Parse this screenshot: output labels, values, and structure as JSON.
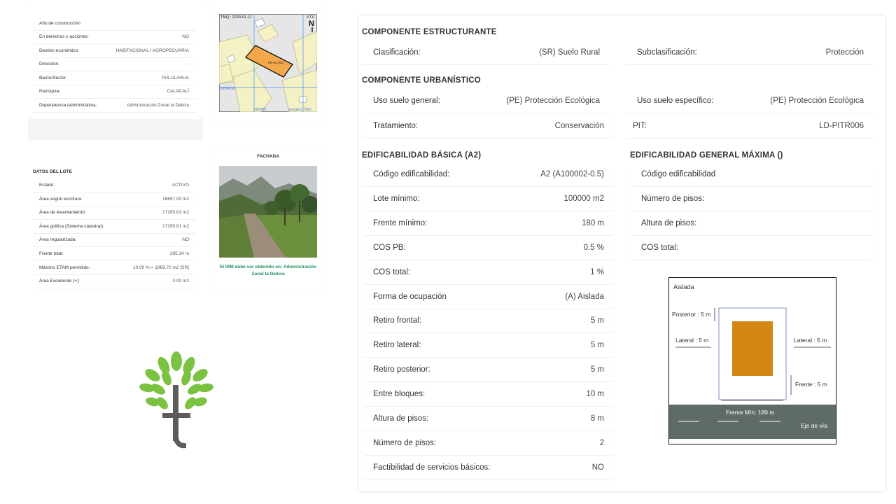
{
  "property_info": {
    "rows": [
      {
        "label": "Año de construcción",
        "value": ""
      },
      {
        "label": "En derechos y acciones:",
        "value": "NO"
      },
      {
        "label": "Destino económico:",
        "value": "HABITACIONAL / AGROPECUARIA"
      },
      {
        "label": "Dirección:",
        "value": "-"
      },
      {
        "label": "Barrio/Sector:",
        "value": "PULULAHUA"
      },
      {
        "label": "Parroquia:",
        "value": "CALACALÍ"
      },
      {
        "label": "Dependencia Administrativa:",
        "value": "Administración Zonal la Delicia"
      }
    ]
  },
  "map": {
    "date_label": "TMQ : 2023-01-11",
    "corner_label": "V.T.0",
    "north": "N",
    "lot_label": "FE-A2 (A1)",
    "coord_left": "10034700",
    "coord_bottom": "501600",
    "scale": "Escala 1:7500"
  },
  "lote": {
    "title": "DATOS DEL LOTE",
    "rows": [
      {
        "label": "Estado:",
        "value": "ACTIVO"
      },
      {
        "label": "Área según escritura:",
        "value": "18697.00 m2"
      },
      {
        "label": "Área de levantamiento:",
        "value": "17295.63 m2"
      },
      {
        "label": "Área gráfica (Sistema catastral):",
        "value": "17295.81 m2"
      },
      {
        "label": "Área regularizada:",
        "value": "NO"
      },
      {
        "label": "Frente total:",
        "value": "285.34 m"
      },
      {
        "label": "Máximo ETAM permitido:",
        "value": "10.00 % = 1869.70 m2 [SR]"
      },
      {
        "label": "Área Excedente (+):",
        "value": "0.00 m2"
      }
    ]
  },
  "fachada": {
    "title": "FACHADA",
    "note": "El IRM debe ser obtenido en: Administración Zonal la Delicia"
  },
  "componente_estructurante": {
    "title": "COMPONENTE ESTRUCTURANTE",
    "clasificacion_label": "Clasificación:",
    "clasificacion_value": "(SR) Suelo Rural",
    "subclasificacion_label": "Subclasificación:",
    "subclasificacion_value": "Protección"
  },
  "componente_urbanistico": {
    "title": "COMPONENTE URBANÍSTICO",
    "uso_general_label": "Uso suelo general:",
    "uso_general_value": "(PE) Protección Ecológica",
    "uso_especifico_label": "Uso suelo específico:",
    "uso_especifico_value": "(PE) Protección Ecológica",
    "tratamiento_label": "Tratamiento:",
    "tratamiento_value": "Conservación",
    "pit_label": "PIT:",
    "pit_value": "LD-PITR006"
  },
  "edificabilidad_basica": {
    "title": "EDIFICABILIDAD BÁSICA (A2)",
    "rows": [
      {
        "label": "Código edificabilidad:",
        "value": "A2 (A100002-0.5)"
      },
      {
        "label": "Lote mínimo:",
        "value": "100000 m2"
      },
      {
        "label": "Frente mínimo:",
        "value": "180 m"
      },
      {
        "label": "COS PB:",
        "value": "0.5 %"
      },
      {
        "label": "COS total:",
        "value": "1 %"
      },
      {
        "label": "Forma de ocupación",
        "value": "(A) Aislada"
      },
      {
        "label": "Retiro frontal:",
        "value": "5 m"
      },
      {
        "label": "Retiro lateral:",
        "value": "5 m"
      },
      {
        "label": "Retiro posterior:",
        "value": "5 m"
      },
      {
        "label": "Entre bloques:",
        "value": "10 m"
      },
      {
        "label": "Altura de pisos:",
        "value": "8 m"
      },
      {
        "label": "Número de pisos:",
        "value": "2"
      },
      {
        "label": "Factibilidad de servicios básicos:",
        "value": "NO"
      }
    ]
  },
  "edificabilidad_maxima": {
    "title": "EDIFICABILIDAD GENERAL MÁXIMA ()",
    "rows": [
      {
        "label": "Código edificabilidad"
      },
      {
        "label": "Número de pisos:"
      },
      {
        "label": "Altura de pisos:"
      },
      {
        "label": "COS total:"
      }
    ]
  },
  "diagram": {
    "title": "Aislada",
    "posterior": "Posterior : 5 m",
    "lateral_left": "Lateral : 5 m",
    "lateral_right": "Lateral : 5 m",
    "frente": "Frente : 5 m",
    "frente_min": "Frente Mín: 180 m",
    "eje": "Eje de vía",
    "building_color": "#d48614",
    "road_color": "#5f6b68"
  },
  "colors": {
    "tree_green": "#7cc242",
    "tree_trunk": "#5c5c5c",
    "note_green": "#1e8e5a"
  }
}
